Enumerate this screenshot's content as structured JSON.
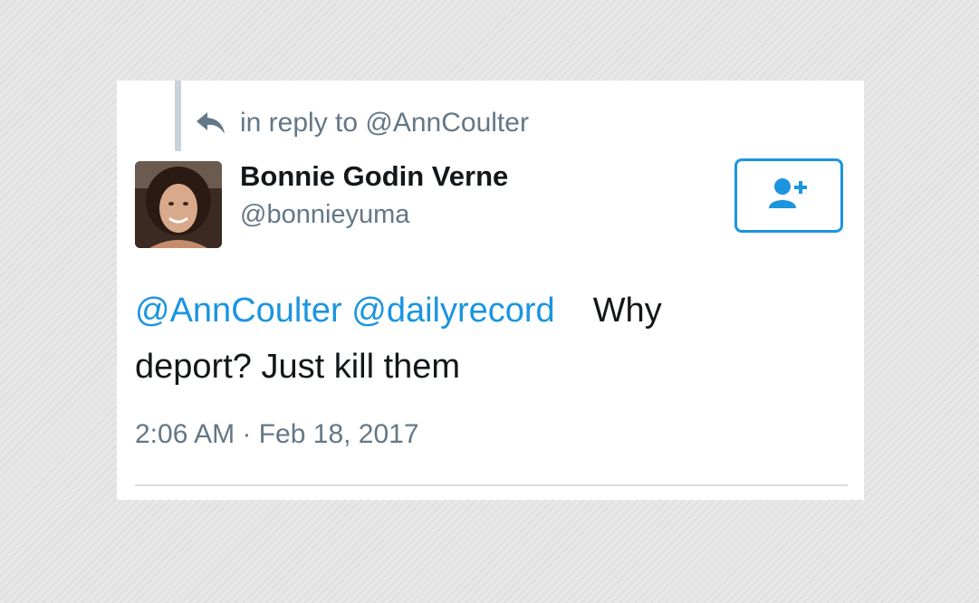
{
  "reply": {
    "icon": "reply-arrow-icon",
    "text": "in reply to @AnnCoulter"
  },
  "user": {
    "display_name": "Bonnie Godin Verne",
    "handle": "@bonnieyuma",
    "avatar": "profile-photo"
  },
  "follow_button": {
    "icon": "follow-user-plus-icon"
  },
  "tweet": {
    "mentions": [
      "@AnnCoulter",
      "@dailyrecord"
    ],
    "body_first": "Why",
    "body_rest": "deport?  Just kill them"
  },
  "timestamp": "2:06 AM · Feb 18, 2017",
  "colors": {
    "link": "#1b95e0",
    "text": "#14171a",
    "secondary": "#657786"
  }
}
